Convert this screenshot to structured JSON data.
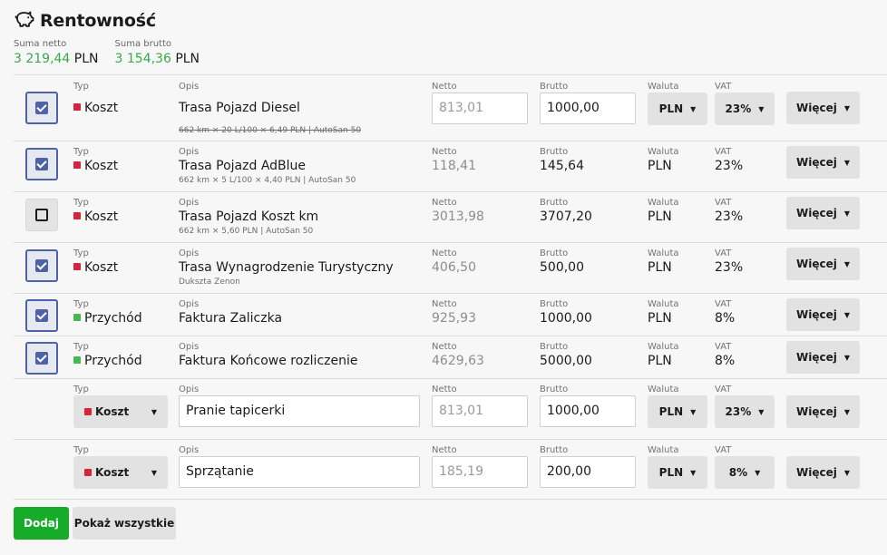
{
  "header": {
    "title": "Rentowność",
    "icon": "piggy-bank-icon"
  },
  "sums": {
    "netto_label": "Suma netto",
    "netto_value": "3 219,44",
    "netto_currency": "PLN",
    "brutto_label": "Suma brutto",
    "brutto_value": "3 154,36",
    "brutto_currency": "PLN"
  },
  "labels": {
    "typ": "Typ",
    "opis": "Opis",
    "netto": "Netto",
    "brutto": "Brutto",
    "waluta": "Waluta",
    "vat": "VAT",
    "more": "Więcej"
  },
  "colors": {
    "koszt": "#d9233d",
    "przychod": "#45b84f",
    "accent": "#4f62a8",
    "add": "#17ab2a"
  },
  "rows": [
    {
      "checked": true,
      "type": "Koszt",
      "desc": "Trasa Pojazd Diesel",
      "sub": "662 km × 20 L/100 × 6,49 PLN | AutoSan 50",
      "netto": "813,01",
      "brutto": "1000,00",
      "waluta": "PLN",
      "vat": "23%"
    },
    {
      "checked": true,
      "type": "Koszt",
      "desc": "Trasa Pojazd AdBlue",
      "sub": "662 km × 5 L/100 × 4,40 PLN | AutoSan 50",
      "netto": "118,41",
      "brutto": "145,64",
      "waluta": "PLN",
      "vat": "23%"
    },
    {
      "checked": false,
      "type": "Koszt",
      "desc": "Trasa Pojazd Koszt km",
      "sub": "662 km × 5,60 PLN | AutoSan 50",
      "netto": "3013,98",
      "brutto": "3707,20",
      "waluta": "PLN",
      "vat": "23%"
    },
    {
      "checked": true,
      "type": "Koszt",
      "desc": "Trasa Wynagrodzenie Turystyczny",
      "sub": "Dukszta Zenon",
      "netto": "406,50",
      "brutto": "500,00",
      "waluta": "PLN",
      "vat": "23%"
    },
    {
      "checked": true,
      "type": "Przychód",
      "desc": "Faktura Zaliczka",
      "sub": "",
      "netto": "925,93",
      "brutto": "1000,00",
      "waluta": "PLN",
      "vat": "8%"
    },
    {
      "checked": true,
      "type": "Przychód",
      "desc": "Faktura Końcowe rozliczenie",
      "sub": "",
      "netto": "4629,63",
      "brutto": "5000,00",
      "waluta": "PLN",
      "vat": "8%"
    },
    {
      "type": "Koszt",
      "desc": "Pranie tapicerki",
      "netto": "813,01",
      "brutto": "1000,00",
      "waluta": "PLN",
      "vat": "23%"
    },
    {
      "type": "Koszt",
      "desc": "Sprzątanie",
      "netto": "185,19",
      "brutto": "200,00",
      "waluta": "PLN",
      "vat": "8%"
    }
  ],
  "footer": {
    "add_label": "Dodaj",
    "show_all_label": "Pokaż wszystkie"
  }
}
